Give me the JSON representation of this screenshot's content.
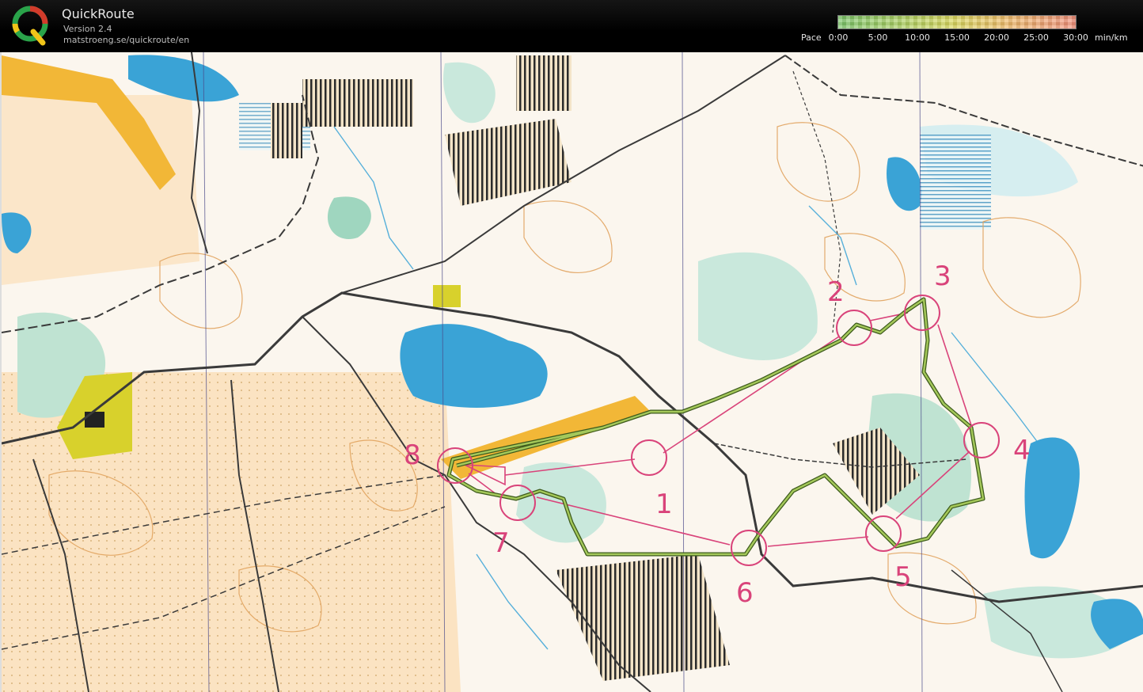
{
  "header": {
    "title": "QuickRoute",
    "version": "Version 2.4",
    "url": "matstroeng.se/quickroute/en"
  },
  "pace_legend": {
    "label": "Pace",
    "ticks": [
      "0:00",
      "5:00",
      "10:00",
      "15:00",
      "20:00",
      "25:00",
      "30:00"
    ],
    "unit": "min/km",
    "gradient_colors": [
      "#7cc56a",
      "#d9d85e",
      "#ef8f7a"
    ]
  },
  "map": {
    "course_color": "#d9437a",
    "route_color": "#6f9b2e",
    "controls": [
      {
        "label": "1"
      },
      {
        "label": "2"
      },
      {
        "label": "3"
      },
      {
        "label": "4"
      },
      {
        "label": "5"
      },
      {
        "label": "6"
      },
      {
        "label": "7"
      },
      {
        "label": "8"
      }
    ]
  }
}
